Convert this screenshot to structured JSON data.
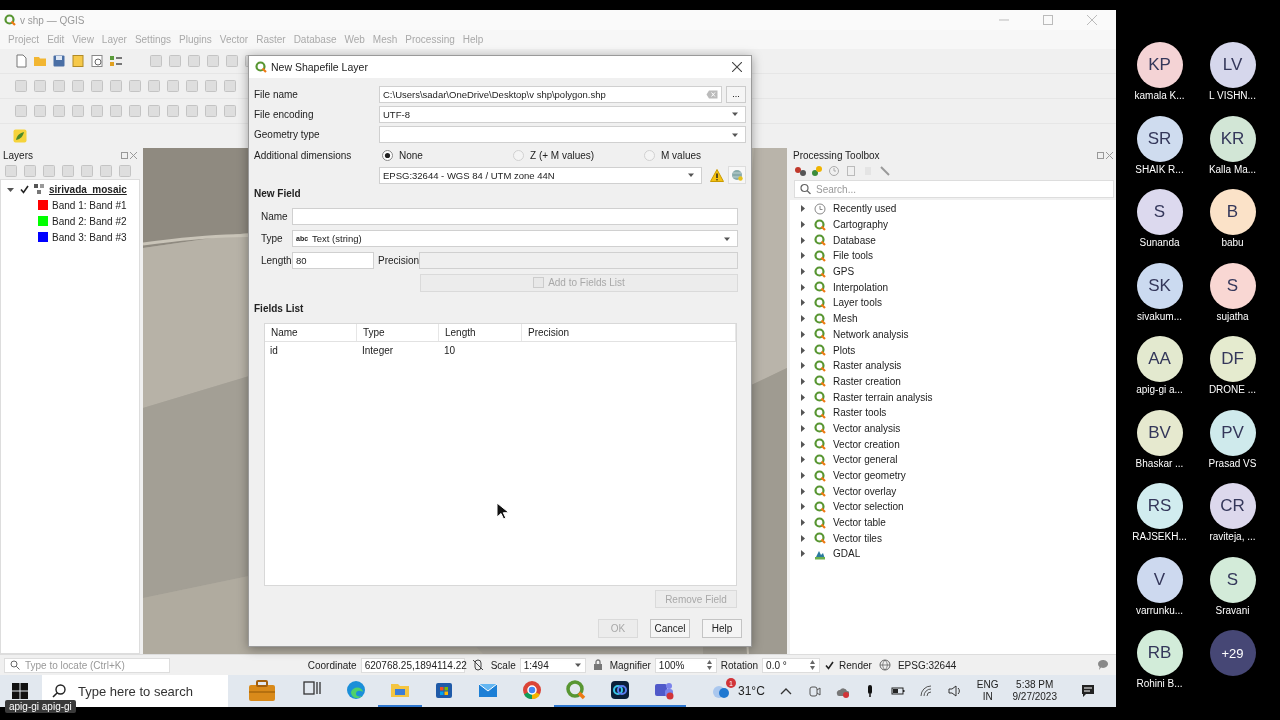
{
  "window": {
    "title": "v shp — QGIS"
  },
  "menu": [
    {
      "label": "Project",
      "disabled": true
    },
    {
      "label": "Edit",
      "disabled": true
    },
    {
      "label": "View",
      "disabled": true
    },
    {
      "label": "Layer",
      "disabled": true
    },
    {
      "label": "Settings",
      "disabled": true
    },
    {
      "label": "Plugins",
      "disabled": true
    },
    {
      "label": "Vector",
      "disabled": true
    },
    {
      "label": "Raster",
      "disabled": true
    },
    {
      "label": "Database",
      "disabled": true
    },
    {
      "label": "Web",
      "disabled": true
    },
    {
      "label": "Mesh",
      "disabled": true
    },
    {
      "label": "Processing",
      "disabled": true
    },
    {
      "label": "Help",
      "disabled": true
    }
  ],
  "layers_panel": {
    "title": "Layers",
    "tree": [
      {
        "label": "sirivada_mosaic",
        "checked": true,
        "expanded": true,
        "children": [
          {
            "label": "Band 1: Band #1",
            "color": "#ff0000"
          },
          {
            "label": "Band 2: Band #2",
            "color": "#00ff00"
          },
          {
            "label": "Band 3: Band #3",
            "color": "#0000ff"
          }
        ]
      }
    ]
  },
  "dialog": {
    "title": "New Shapefile Layer",
    "file_name": {
      "label": "File name",
      "value": "C:\\Users\\sadar\\OneDrive\\Desktop\\v shp\\polygon.shp",
      "browse": "..."
    },
    "file_encoding": {
      "label": "File encoding",
      "value": "UTF-8"
    },
    "geometry_type": {
      "label": "Geometry type"
    },
    "additional_dimensions": {
      "label": "Additional dimensions",
      "options": [
        {
          "label": "None",
          "selected": true
        },
        {
          "label": "Z (+ M values)",
          "selected": false
        },
        {
          "label": "M values",
          "selected": false
        }
      ]
    },
    "crs": {
      "value": "EPSG:32644 - WGS 84 / UTM zone 44N"
    },
    "new_field": {
      "title": "New Field",
      "name_label": "Name",
      "type_label": "Type",
      "type_badge": "abc",
      "type_value": "Text (string)",
      "length_label": "Length",
      "length_value": "80",
      "precision_label": "Precision",
      "precision_disabled": true,
      "add_button": {
        "label": "Add to Fields List",
        "disabled": true
      }
    },
    "fields_list": {
      "title": "Fields List",
      "columns": [
        "Name",
        "Type",
        "Length",
        "Precision"
      ],
      "rows": [
        [
          "id",
          "Integer",
          "10"
        ]
      ],
      "remove_button": {
        "label": "Remove Field",
        "disabled": true
      }
    },
    "buttons": [
      {
        "label": "OK",
        "disabled": true
      },
      {
        "label": "Cancel",
        "disabled": false
      },
      {
        "label": "Help",
        "disabled": false
      }
    ]
  },
  "toolbox": {
    "title": "Processing Toolbox",
    "search_placeholder": "Search...",
    "items": [
      {
        "label": "Recently used",
        "kind": "recent",
        "expanded": false
      },
      {
        "label": "Cartography",
        "kind": "qgis",
        "expanded": false
      },
      {
        "label": "Database",
        "kind": "qgis",
        "expanded": false
      },
      {
        "label": "File tools",
        "kind": "qgis",
        "expanded": false
      },
      {
        "label": "GPS",
        "kind": "qgis",
        "expanded": false
      },
      {
        "label": "Interpolation",
        "kind": "qgis",
        "expanded": false
      },
      {
        "label": "Layer tools",
        "kind": "qgis",
        "expanded": false
      },
      {
        "label": "Mesh",
        "kind": "qgis",
        "expanded": false
      },
      {
        "label": "Network analysis",
        "kind": "qgis",
        "expanded": false
      },
      {
        "label": "Plots",
        "kind": "qgis",
        "expanded": false
      },
      {
        "label": "Raster analysis",
        "kind": "qgis",
        "expanded": false
      },
      {
        "label": "Raster creation",
        "kind": "qgis",
        "expanded": false
      },
      {
        "label": "Raster terrain analysis",
        "kind": "qgis",
        "expanded": false
      },
      {
        "label": "Raster tools",
        "kind": "qgis",
        "expanded": false
      },
      {
        "label": "Vector analysis",
        "kind": "qgis",
        "expanded": false
      },
      {
        "label": "Vector creation",
        "kind": "qgis",
        "expanded": false
      },
      {
        "label": "Vector general",
        "kind": "qgis",
        "expanded": false
      },
      {
        "label": "Vector geometry",
        "kind": "qgis",
        "expanded": false
      },
      {
        "label": "Vector overlay",
        "kind": "qgis",
        "expanded": false
      },
      {
        "label": "Vector selection",
        "kind": "qgis",
        "expanded": false
      },
      {
        "label": "Vector table",
        "kind": "qgis",
        "expanded": false
      },
      {
        "label": "Vector tiles",
        "kind": "qgis",
        "expanded": false
      },
      {
        "label": "GDAL",
        "kind": "gdal",
        "expanded": false
      }
    ]
  },
  "status_bar": {
    "locate_placeholder": "Type to locate (Ctrl+K)",
    "coordinate_label": "Coordinate",
    "coordinate": "620768.25,1894114.22",
    "scale_label": "Scale",
    "scale": "1:494",
    "magnifier_label": "Magnifier",
    "magnifier": "100%",
    "rotation_label": "Rotation",
    "rotation": "0.0 °",
    "render": {
      "label": "Render",
      "checked": true
    },
    "crs": "EPSG:32644"
  },
  "taskbar": {
    "search_placeholder": "Type here to search",
    "apps": [
      {
        "kind": "taskview",
        "running": false
      },
      {
        "kind": "edge",
        "running": false
      },
      {
        "kind": "explorer",
        "running": true
      },
      {
        "kind": "store",
        "running": false
      },
      {
        "kind": "mail",
        "running": false
      },
      {
        "kind": "chrome",
        "running": false
      },
      {
        "kind": "qgis",
        "running": true
      },
      {
        "kind": "app",
        "running": true
      },
      {
        "kind": "teams",
        "running": true
      }
    ],
    "weather": {
      "badge": "1",
      "temperature": "31°C"
    },
    "language": "ENG",
    "region": "IN",
    "time": "5:38 PM",
    "date": "9/27/2023"
  },
  "tooltip": "apig-gi apig-gi",
  "participants": [
    {
      "initials": "KP",
      "name": "kamala K...",
      "color": "#f4d3d5"
    },
    {
      "initials": "LV",
      "name": "L VISHN...",
      "color": "#d6d7ec"
    },
    {
      "initials": "SR",
      "name": "SHAIK R...",
      "color": "#cfdcef"
    },
    {
      "initials": "KR",
      "name": "Kalla Ma...",
      "color": "#d2e6d6"
    },
    {
      "initials": "S",
      "name": "Sunanda",
      "color": "#dcd9ee"
    },
    {
      "initials": "B",
      "name": "babu",
      "color": "#fbe2c8"
    },
    {
      "initials": "SK",
      "name": "sivakum...",
      "color": "#cbdaf0"
    },
    {
      "initials": "S",
      "name": "sujatha",
      "color": "#f9d7d3"
    },
    {
      "initials": "AA",
      "name": "apig-gi a...",
      "color": "#e3e9cf"
    },
    {
      "initials": "DF",
      "name": "DRONE ...",
      "color": "#e5ebcf"
    },
    {
      "initials": "BV",
      "name": "Bhaskar ...",
      "color": "#e6e9cf"
    },
    {
      "initials": "PV",
      "name": "Prasad VS",
      "color": "#cfeaec"
    },
    {
      "initials": "RS",
      "name": "RAJSEKH...",
      "color": "#d1ecef"
    },
    {
      "initials": "CR",
      "name": "raviteja, ...",
      "color": "#dcd8ec"
    },
    {
      "initials": "V",
      "name": "varrunku...",
      "color": "#cdd9ef"
    },
    {
      "initials": "S",
      "name": "Sravani",
      "color": "#d3ebd9"
    },
    {
      "initials": "RB",
      "name": "Rohini B...",
      "color": "#d2ecd9"
    }
  ],
  "more_participants": "+29"
}
